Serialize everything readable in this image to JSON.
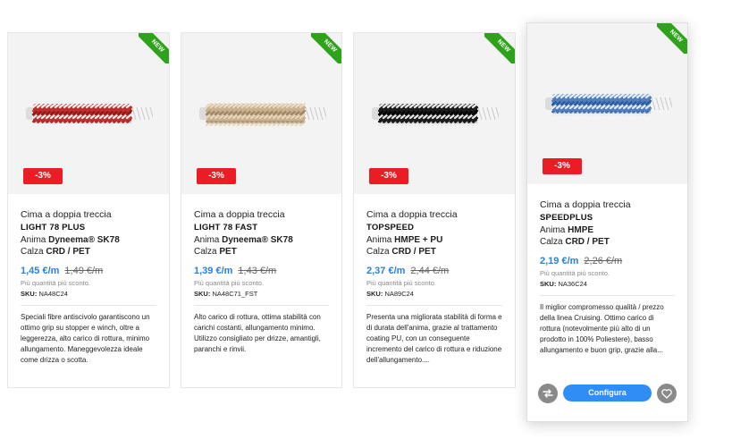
{
  "products": [
    {
      "badge": "NEW",
      "discount": "-3%",
      "type": "Cima a doppia treccia",
      "name": "LIGHT 78 PLUS",
      "core_label": "Anima",
      "core_value": "Dyneema® SK78",
      "cover_label": "Calza",
      "cover_value": "CRD / PET",
      "price_new": "1,45 €/m",
      "price_old": "1,49 €/m",
      "discount_note": "Più quantità più sconto.",
      "sku_label": "SKU:",
      "sku_value": "NA48C24",
      "description": "Speciali fibre antiscivolo garantiscono un ottimo grip su stopper e winch, oltre a leggerezza, alto carico di rottura, minimo allungamento. Maneggevolezza ideale come drizza o scotta.",
      "rope_colors": {
        "base": "#c42d2d",
        "alt": "#f2f2f2",
        "dark": "#8c1a1a"
      }
    },
    {
      "badge": "NEW",
      "discount": "-3%",
      "type": "Cima a doppia treccia",
      "name": "LIGHT 78 FAST",
      "core_label": "Anima",
      "core_value": "Dyneema® SK78",
      "cover_label": "Calza",
      "cover_value": "PET",
      "price_new": "1,39 €/m",
      "price_old": "1,43 €/m",
      "discount_note": "Più quantità più sconto.",
      "sku_label": "SKU:",
      "sku_value": "NA48C71_FST",
      "description": "Alto carico di rottura, ottima stabilità con carichi costanti, allungamento minimo. Utilizzo consigliato per drizze, amantigli, paranchi e rinvii.",
      "rope_colors": {
        "base": "#c9b08e",
        "alt": "#e6d6bd",
        "dark": "#9d8563"
      }
    },
    {
      "badge": "NEW",
      "discount": "-3%",
      "type": "Cima a doppia treccia",
      "name": "TOPSPEED",
      "core_label": "Anima",
      "core_value": "HMPE + PU",
      "cover_label": "Calza",
      "cover_value": "CRD / PET",
      "price_new": "2,37 €/m",
      "price_old": "2,44 €/m",
      "discount_note": "Più quantità più sconto.",
      "sku_label": "SKU:",
      "sku_value": "NA89C24",
      "description": "Presenta una migliorata stabilità di forma e di durata dell'anima, grazie al trattamento coating PU, con un conseguente incremento del carico di rottura e riduzione dell'allungamento....",
      "rope_colors": {
        "base": "#1c1c1c",
        "alt": "#e8e8e8",
        "dark": "#000000"
      }
    },
    {
      "badge": "NEW",
      "discount": "-3%",
      "type": "Cima a doppia treccia",
      "name": "SPEEDPLUS",
      "core_label": "Anima",
      "core_value": "HMPE",
      "cover_label": "Calza",
      "cover_value": "CRD / PET",
      "price_new": "2,19 €/m",
      "price_old": "2,26 €/m",
      "discount_note": "Più quantità più sconto.",
      "sku_label": "SKU:",
      "sku_value": "NA36C24",
      "description": "Il miglior compromesso qualità / prezzo della linea Cruising. Ottimo carico di rottura (notevolmente più alto di un prodotto in 100% Poliestere), basso allungamento e buon grip, grazie alla...",
      "rope_colors": {
        "base": "#4f7fc1",
        "alt": "#e9eef6",
        "dark": "#2c5a9a"
      },
      "configure_label": "Configura",
      "compare_icon": "compare-arrows-icon",
      "favorite_icon": "heart-icon"
    }
  ],
  "colors": {
    "accent": "#2f8df5",
    "price": "#2b7fe0",
    "discount_badge": "#ec1c24",
    "new_ribbon": "#2ea21a"
  }
}
